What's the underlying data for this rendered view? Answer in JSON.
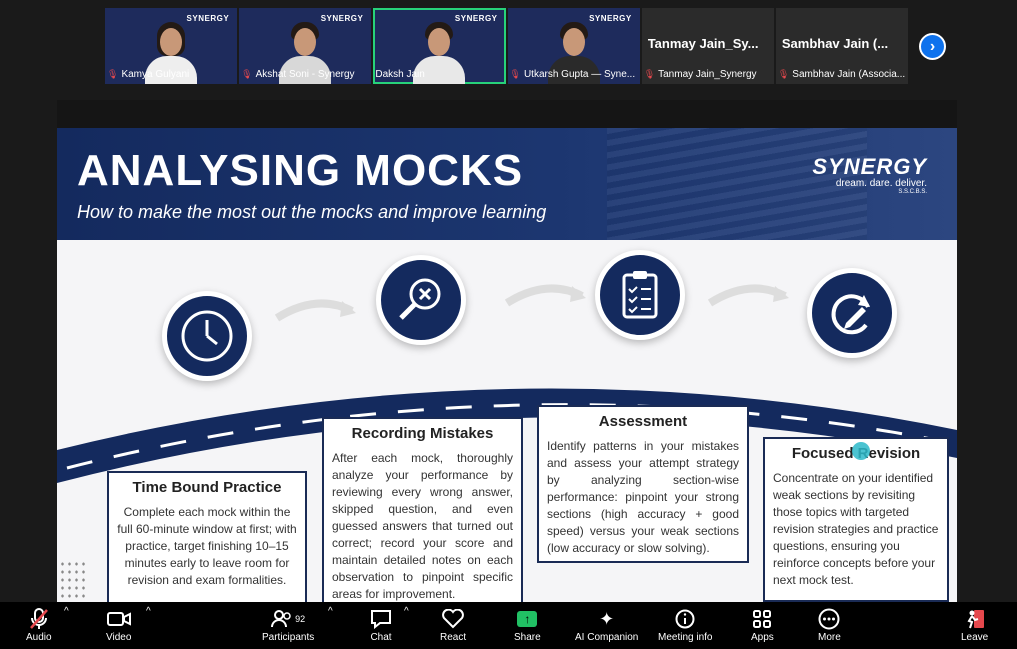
{
  "participants": [
    {
      "name": "Kamya Gulyani",
      "muted": true,
      "logo": "SYNERGY"
    },
    {
      "name": "Akshat Soni - Synergy",
      "muted": true,
      "logo": "SYNERGY"
    },
    {
      "name": "Daksh Jain",
      "muted": false,
      "logo": "SYNERGY",
      "speaking": true
    },
    {
      "name": "Utkarsh Gupta — Syne...",
      "muted": true,
      "logo": "SYNERGY"
    },
    {
      "name": "Tanmay Jain_Synergy",
      "title": "Tanmay Jain_Sy...",
      "muted": true
    },
    {
      "name": "Sambhav Jain (Associa...",
      "title": "Sambhav Jain (...",
      "muted": true
    }
  ],
  "slide": {
    "title": "ANALYSING MOCKS",
    "subtitle": "How to make the most out the mocks and improve learning",
    "brand": {
      "name": "SYNERGY",
      "tagline": "dream. dare. deliver.",
      "sub": "S.S.C.B.S."
    },
    "steps": [
      {
        "icon": "clock-icon",
        "heading": "Time Bound Practice",
        "body": "Complete each mock within the full 60-minute window at first; with practice, target finishing 10–15 minutes early to leave room for revision and exam formalities."
      },
      {
        "icon": "magnifier-x-icon",
        "heading": "Recording Mistakes",
        "body": "After each mock, thoroughly analyze your performance by reviewing every wrong answer, skipped question, and even guessed answers that turned out correct; record your score and maintain detailed notes on each observation to pinpoint specific areas for improvement."
      },
      {
        "icon": "clipboard-checklist-icon",
        "heading": "Assessment",
        "body": "Identify patterns in your mistakes and assess your attempt strategy by analyzing section-wise performance: pinpoint your strong sections (high accuracy + good speed) versus your weak sections (low accuracy or slow solving)."
      },
      {
        "icon": "refresh-pencil-icon",
        "heading": "Focused Revision",
        "body": "Concentrate on your identified weak sections by revisiting those topics with targeted revision strategies and practice questions, ensuring you reinforce concepts before your next mock test."
      }
    ]
  },
  "toolbar": {
    "audio": "Audio",
    "video": "Video",
    "participants": "Participants",
    "participants_count": "92",
    "chat": "Chat",
    "react": "React",
    "share": "Share",
    "ai_companion": "AI Companion",
    "meeting_info": "Meeting info",
    "apps": "Apps",
    "more": "More",
    "leave": "Leave"
  },
  "colors": {
    "navy": "#142a5e",
    "speaking_border": "#27d27a",
    "share_green": "#21c064",
    "accent_blue": "#0e72ed",
    "muted_red": "#e5484d"
  }
}
